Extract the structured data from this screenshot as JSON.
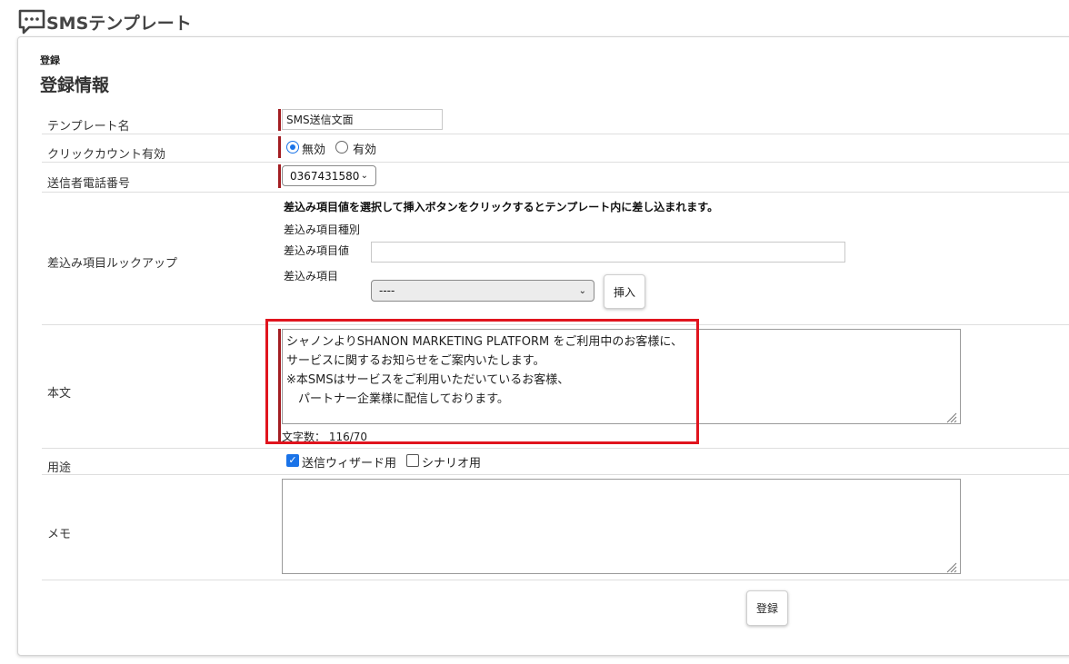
{
  "app": {
    "title": "SMSテンプレート",
    "icon": "chat-bubble-icon"
  },
  "section": {
    "label": "登録",
    "title": "登録情報"
  },
  "fields": {
    "template_name": {
      "label": "テンプレート名",
      "value": "SMS送信文面"
    },
    "click_count": {
      "label": "クリックカウント有効",
      "options": [
        "無効",
        "有効"
      ],
      "selected": "無効"
    },
    "sender_phone": {
      "label": "送信者電話番号",
      "value": "0367431580"
    },
    "merge_lookup": {
      "label": "差込み項目ルックアップ",
      "instruction": "差込み項目値を選択して挿入ボタンをクリックするとテンプレート内に差し込まれます。",
      "type_label": "差込み項目種別",
      "value_label": "差込み項目値",
      "value": "",
      "item_label": "差込み項目",
      "item_selected": "----",
      "insert_button": "挿入"
    },
    "body": {
      "label": "本文",
      "text": "シャノンよりSHANON MARKETING PLATFORM をご利用中のお客様に、\nサービスに関するお知らせをご案内いたします。\n※本SMSはサービスをご利用いただいているお客様、\n　パートナー企業様に配信しております。",
      "char_count_label": "文字数：",
      "char_count": "116/70"
    },
    "usage": {
      "label": "用途",
      "options": [
        {
          "label": "送信ウィザード用",
          "checked": true
        },
        {
          "label": "シナリオ用",
          "checked": false
        }
      ]
    },
    "memo": {
      "label": "メモ",
      "value": ""
    }
  },
  "actions": {
    "register_button": "登録"
  },
  "colors": {
    "required_bar": "#a31d22",
    "highlight": "#e0141e",
    "accent": "#1a73e8"
  }
}
